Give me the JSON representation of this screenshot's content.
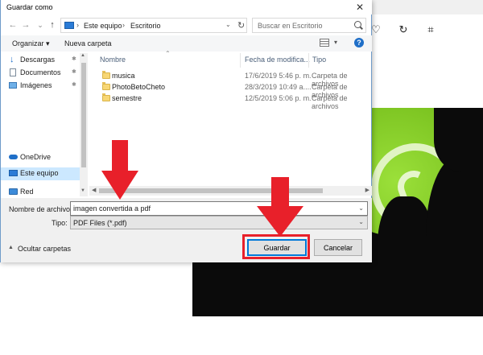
{
  "dialog": {
    "title": "Guardar como",
    "close_glyph": "✕"
  },
  "nav": {
    "back_glyph": "←",
    "forward_glyph": "→",
    "recent_glyph": "⌄",
    "up_glyph": "↑",
    "breadcrumb": [
      "Este equipo",
      "Escritorio"
    ],
    "search_placeholder": "Buscar en Escritorio"
  },
  "cmdbar": {
    "organize_label": "Organizar ▾",
    "new_folder_label": "Nueva carpeta",
    "help_glyph": "?"
  },
  "sidebar": {
    "items": [
      {
        "label": "Descargas",
        "icon": "download-icon"
      },
      {
        "label": "Documentos",
        "icon": "document-icon"
      },
      {
        "label": "Imágenes",
        "icon": "pictures-icon"
      },
      {
        "label": "OneDrive",
        "icon": "cloud-icon"
      },
      {
        "label": "Este equipo",
        "icon": "computer-icon"
      },
      {
        "label": "Red",
        "icon": "network-icon"
      }
    ]
  },
  "filelist": {
    "columns": [
      "Nombre",
      "Fecha de modifica...",
      "Tipo"
    ],
    "rows": [
      {
        "name": "musica",
        "date": "17/6/2019 5:46 p. m.",
        "type": "Carpeta de archivos"
      },
      {
        "name": "PhotoBetoCheto",
        "date": "28/3/2019 10:49 a....",
        "type": "Carpeta de archivos"
      },
      {
        "name": "semestre",
        "date": "12/5/2019 5:06 p. m.",
        "type": "Carpeta de archivos"
      }
    ]
  },
  "form": {
    "filename_label": "Nombre de archivo:",
    "filename_value": "imagen convertida a pdf",
    "type_label": "Tipo:",
    "type_value": "PDF Files (*.pdf)",
    "hide_folders_label": "Ocultar carpetas",
    "save_label": "Guardar",
    "cancel_label": "Cancelar"
  },
  "background_app": {
    "icons": [
      "heart-icon",
      "rotate-icon",
      "crop-icon"
    ]
  },
  "colors": {
    "accent": "#0078d7",
    "annotation_red": "#e8202a",
    "selection": "#cce8ff"
  }
}
